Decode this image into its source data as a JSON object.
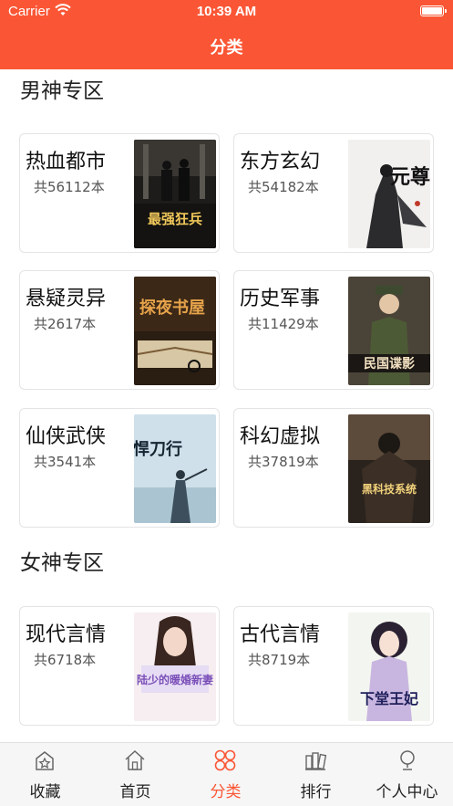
{
  "status_bar": {
    "carrier": "Carrier",
    "time": "10:39 AM"
  },
  "nav": {
    "title": "分类"
  },
  "sections": [
    {
      "title": "男神专区",
      "items": [
        {
          "name": "热血都市",
          "count": "共56112本",
          "cover_text": "最强狂兵"
        },
        {
          "name": "东方玄幻",
          "count": "共54182本",
          "cover_text": "元尊"
        },
        {
          "name": "悬疑灵异",
          "count": "共2617本",
          "cover_text": "探夜书屋"
        },
        {
          "name": "历史军事",
          "count": "共11429本",
          "cover_text": "民国谍影"
        },
        {
          "name": "仙侠武侠",
          "count": "共3541本",
          "cover_text": "悍刀行"
        },
        {
          "name": "科幻虚拟",
          "count": "共37819本",
          "cover_text": "黑科技系统"
        }
      ]
    },
    {
      "title": "女神专区",
      "items": [
        {
          "name": "现代言情",
          "count": "共6718本",
          "cover_text": "陆少的暖婚新妻"
        },
        {
          "name": "古代言情",
          "count": "共8719本",
          "cover_text": "下堂王妃"
        }
      ]
    }
  ],
  "tabbar": {
    "active_color": "#FA5635",
    "tabs": [
      {
        "label": "收藏",
        "icon": "star-house-icon"
      },
      {
        "label": "首页",
        "icon": "home-icon"
      },
      {
        "label": "分类",
        "icon": "category-grid-icon"
      },
      {
        "label": "排行",
        "icon": "ranking-books-icon"
      },
      {
        "label": "个人中心",
        "icon": "user-profile-icon"
      }
    ]
  },
  "colors": {
    "header": "#FA5635"
  }
}
